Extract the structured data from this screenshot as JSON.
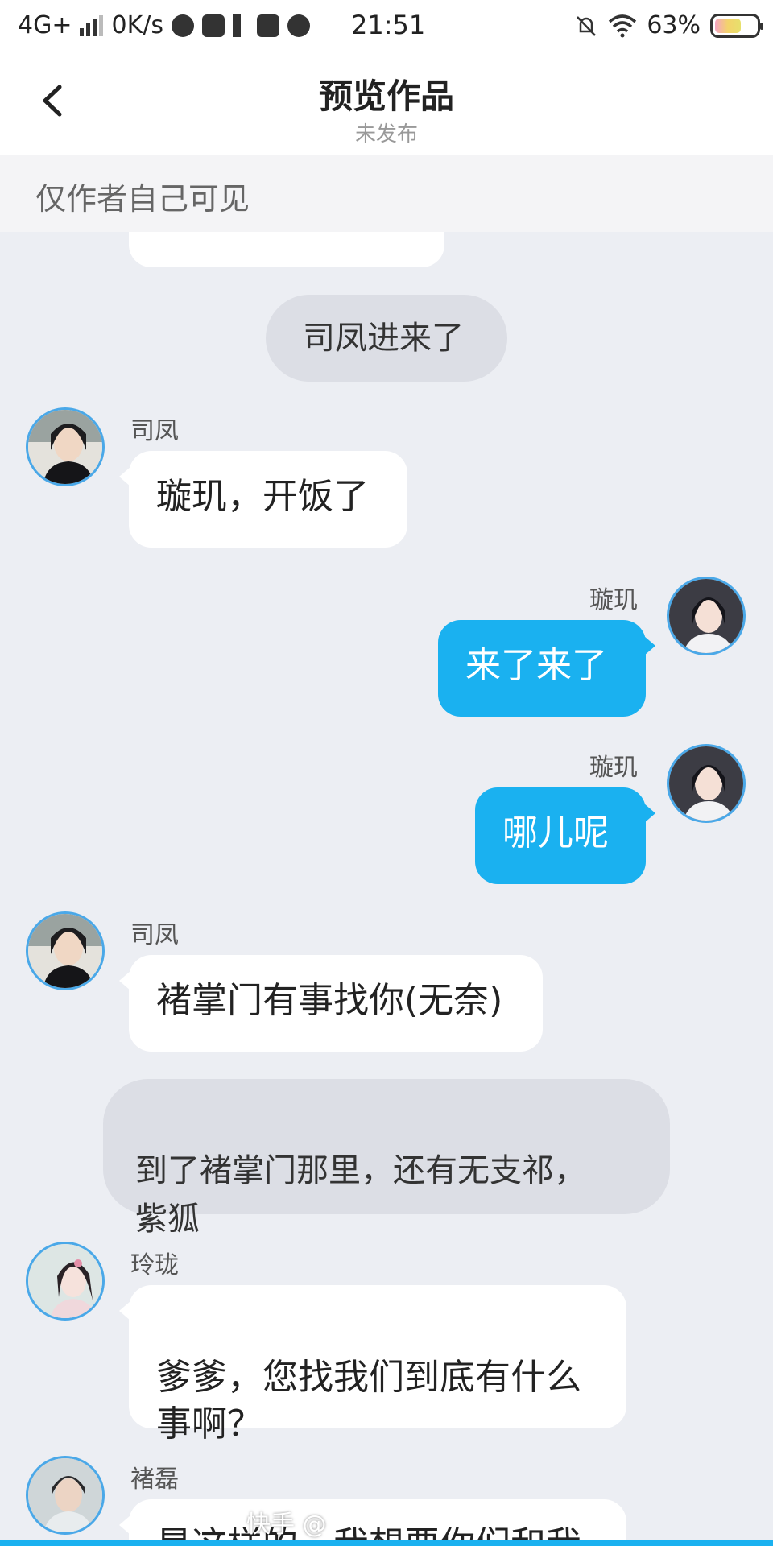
{
  "status_bar": {
    "network": "4G+",
    "speed": "0K/s",
    "time": "21:51",
    "battery": "63%",
    "battery_level": 0.63
  },
  "header": {
    "title": "预览作品",
    "subtitle": "未发布"
  },
  "notice": "仅作者自己可见",
  "messages": [
    {
      "id": "m0",
      "type": "partial",
      "text": "…"
    },
    {
      "id": "m1",
      "type": "narration",
      "text": "司凤进来了"
    },
    {
      "id": "m2",
      "type": "left",
      "name": "司凤",
      "text": "璇玑，开饭了"
    },
    {
      "id": "m3",
      "type": "right",
      "name": "璇玑",
      "text": "来了来了"
    },
    {
      "id": "m4",
      "type": "right",
      "name": "璇玑",
      "text": "哪儿呢"
    },
    {
      "id": "m5",
      "type": "left",
      "name": "司凤",
      "text": "褚掌门有事找你(无奈)"
    },
    {
      "id": "m6",
      "type": "narration",
      "text": "到了褚掌门那里，还有无支祁，\n紫狐"
    },
    {
      "id": "m7",
      "type": "left",
      "name": "玲珑",
      "text": "爹爹，您找我们到底有什么\n事啊？"
    },
    {
      "id": "m8",
      "type": "left",
      "name": "褚磊",
      "text": "是这样的，我想要你们和我"
    }
  ],
  "watermark": "快手 @",
  "colors": {
    "accent": "#1ab1f0",
    "background": "#eceef3",
    "narration_bg": "#dcdee5"
  },
  "icons": [
    "back-arrow-icon",
    "signal-icon",
    "wifi-icon",
    "mute-bell-icon",
    "battery-icon",
    "avatar"
  ]
}
